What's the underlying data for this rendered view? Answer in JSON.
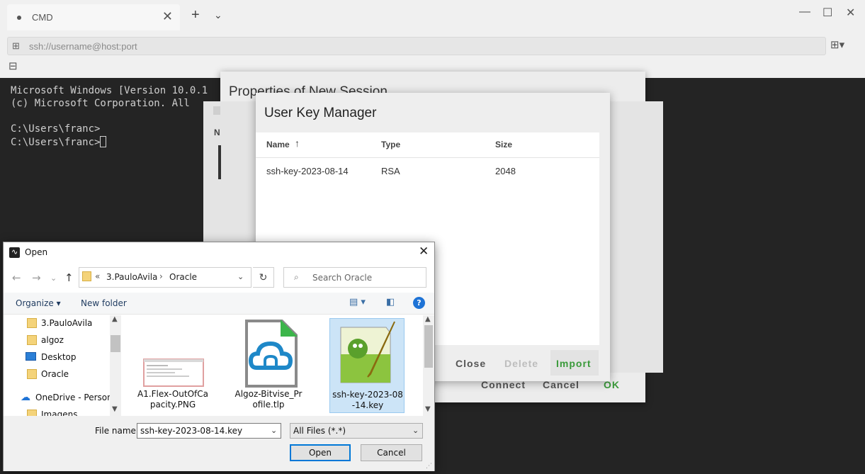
{
  "app": {
    "tab_title": "CMD",
    "tab_close": "✕",
    "new_tab": "+",
    "tab_menu": "⌄",
    "window_controls": [
      "—",
      "☐",
      "✕"
    ],
    "address_placeholder": "ssh://username@host:port"
  },
  "terminal": {
    "lines": [
      "Microsoft Windows [Version 10.0.1",
      "(c) Microsoft Corporation. All",
      "",
      "C:\\Users\\franc>",
      "C:\\Users\\franc>"
    ]
  },
  "properties_dialog": {
    "title": "Properties of New Session",
    "mid_label": "N",
    "connect": "Connect",
    "cancel": "Cancel",
    "ok": "OK"
  },
  "user_key_manager": {
    "title": "User Key Manager",
    "columns": [
      "Name",
      "Type",
      "Size"
    ],
    "rows": [
      {
        "name": "ssh-key-2023-08-14",
        "type": "RSA",
        "size": "2048"
      }
    ],
    "buttons": {
      "close": "Close",
      "delete": "Delete",
      "import": "Import"
    }
  },
  "open_dialog": {
    "title": "Open",
    "path": [
      "3.PauloAvila",
      "Oracle"
    ],
    "search_placeholder": "Search Oracle",
    "organize": "Organize ▾",
    "new_folder": "New folder",
    "help": "?",
    "nav_items": [
      {
        "label": "3.PauloAvila",
        "icon": "folder-icon"
      },
      {
        "label": "algoz",
        "icon": "folder-icon"
      },
      {
        "label": "Desktop",
        "icon": "desktop-icon"
      },
      {
        "label": "Oracle",
        "icon": "folder-icon"
      },
      {
        "label": "OneDrive - Personal",
        "icon": "onedrive-icon"
      },
      {
        "label": "Imagens",
        "icon": "folder-icon"
      }
    ],
    "files": [
      {
        "name": "A1.Flex-OutOfCapacity.PNG",
        "icon": "png-thumbnail-icon"
      },
      {
        "name": "Algoz-Bitvise_Profile.tlp",
        "icon": "bitvise-profile-icon"
      },
      {
        "name": "ssh-key-2023-08-14.key",
        "icon": "notepad-plus-plus-icon"
      }
    ],
    "file_name_label": "File name:",
    "file_name_value": "ssh-key-2023-08-14.key",
    "filter_value": "All Files (*.*)",
    "open_button": "Open",
    "cancel_button": "Cancel"
  }
}
